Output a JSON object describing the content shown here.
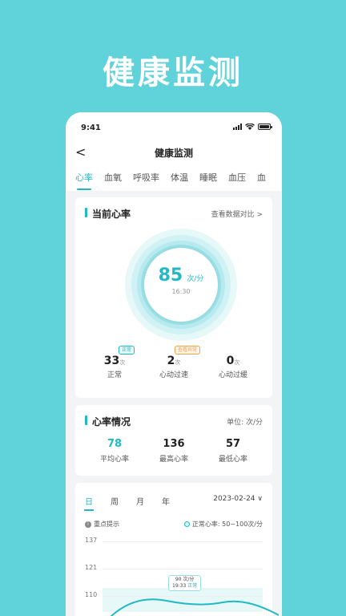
{
  "promo_title": "健康监测",
  "status_bar": {
    "time": "9:41"
  },
  "nav": {
    "back_glyph": "<",
    "title": "健康监测"
  },
  "tabs": [
    {
      "label": "心率",
      "active": true
    },
    {
      "label": "血氧"
    },
    {
      "label": "呼吸率"
    },
    {
      "label": "体温"
    },
    {
      "label": "睡眠"
    },
    {
      "label": "血压"
    },
    {
      "label": "血"
    }
  ],
  "current": {
    "title": "当前心率",
    "link": "查看数据对比 >",
    "bpm": "85",
    "bpm_unit": "次/分",
    "time": "16:30",
    "stats": [
      {
        "value": "33",
        "unit": "次",
        "label": "正常",
        "badge": "正常"
      },
      {
        "value": "2",
        "unit": "次",
        "label": "心动过速",
        "badge": "查看异常"
      },
      {
        "value": "0",
        "unit": "次",
        "label": "心动过缓"
      }
    ]
  },
  "summary": {
    "title": "心率情况",
    "unit": "单位: 次/分",
    "stats": [
      {
        "value": "78",
        "label": "平均心率"
      },
      {
        "value": "136",
        "label": "最高心率"
      },
      {
        "value": "57",
        "label": "最低心率"
      }
    ]
  },
  "history": {
    "periods": [
      "日",
      "周",
      "月",
      "年"
    ],
    "active_period": "日",
    "date": "2023-02-24 ∨",
    "hint": "重点提示",
    "legend": "正常心率: 50~100次/分",
    "y_ticks": [
      "137",
      "121",
      "110"
    ],
    "tooltip": {
      "value": "90 次/分",
      "time": "19:33",
      "tag": "正常"
    }
  },
  "colors": {
    "accent": "#22b8c4",
    "background": "#5fd3d9",
    "warn": "#f0a44c"
  }
}
